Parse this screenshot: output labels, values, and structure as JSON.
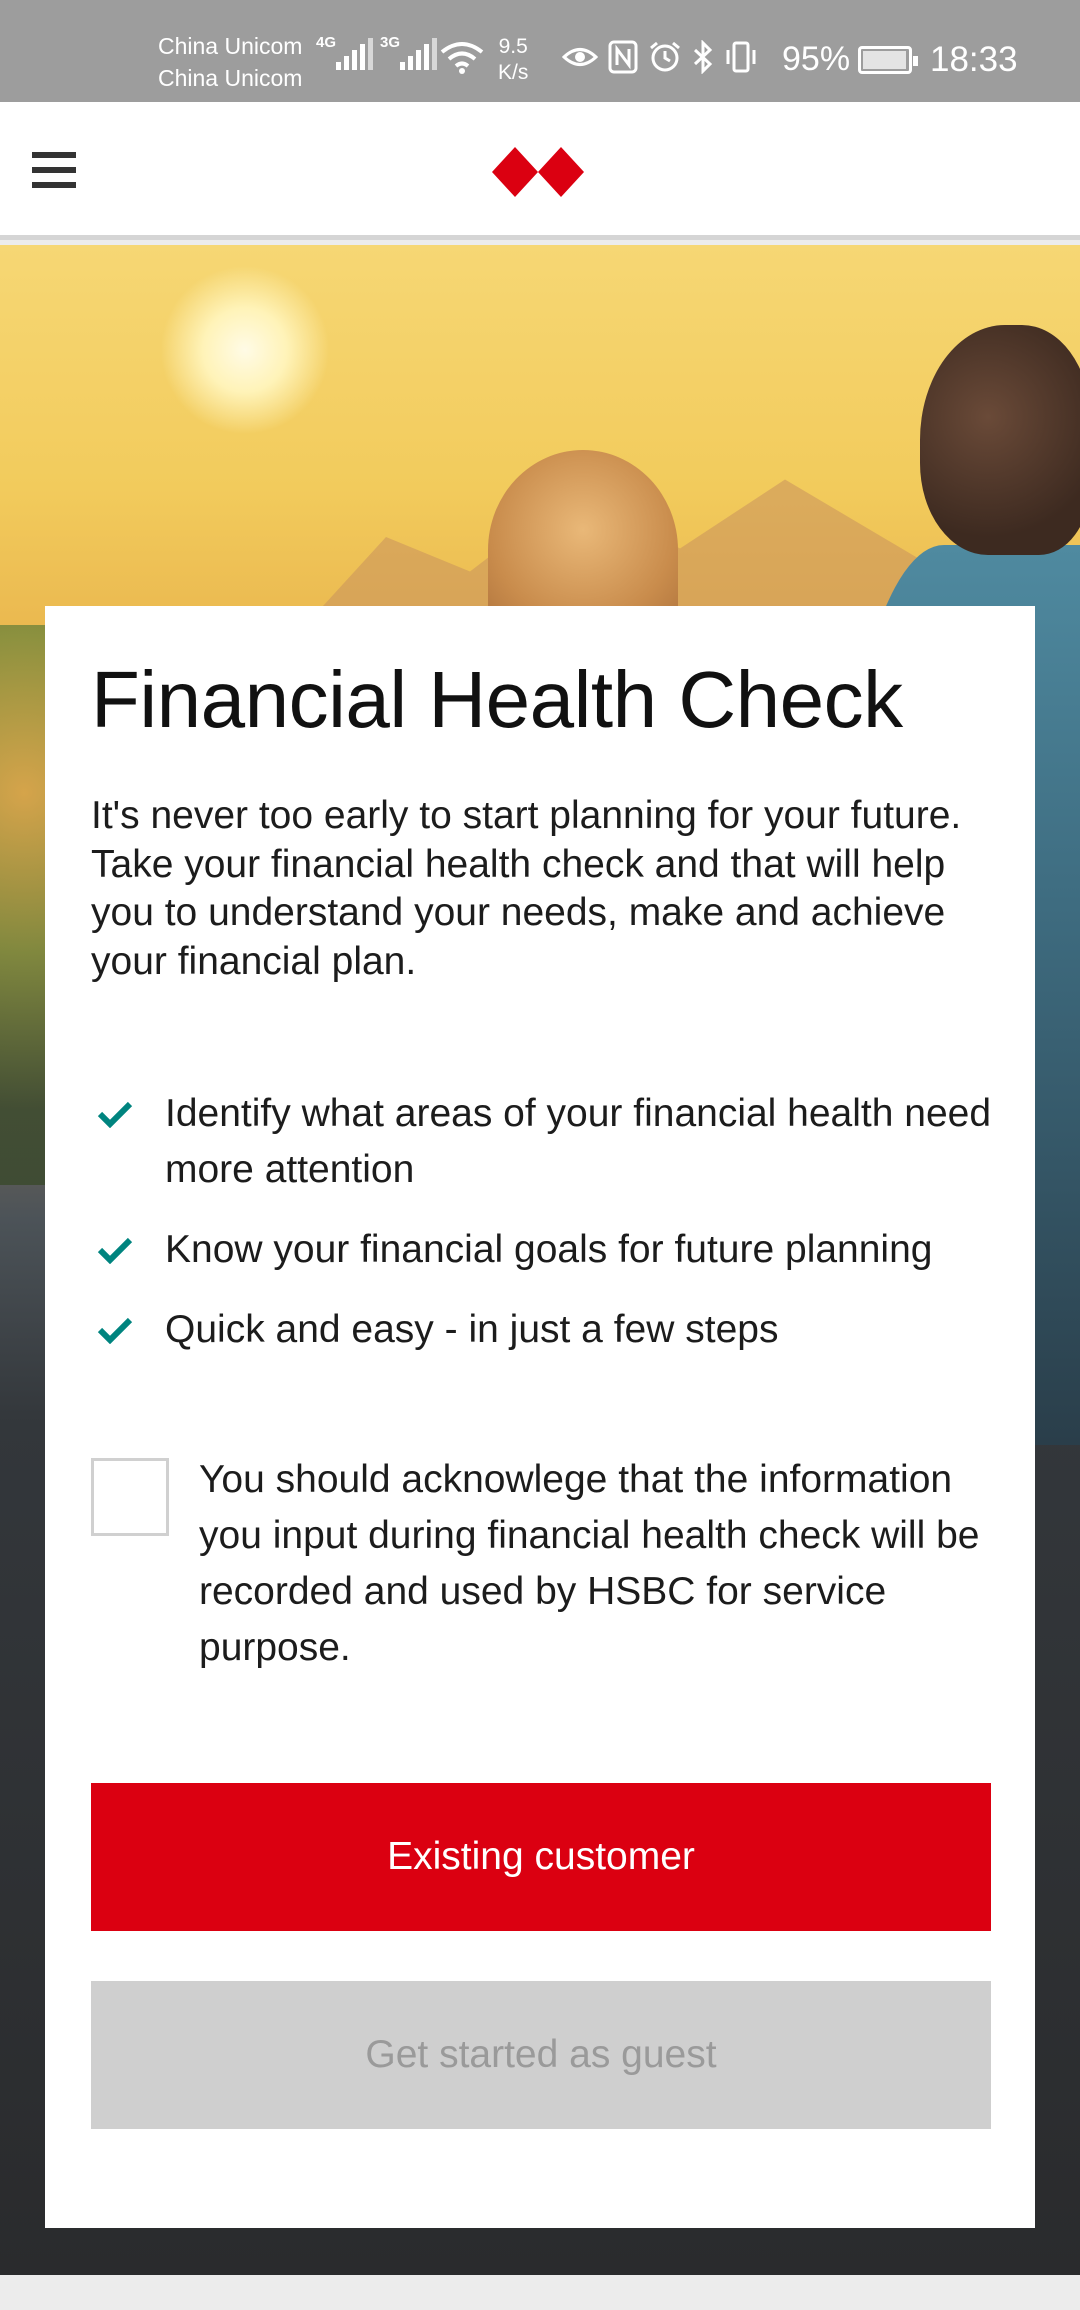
{
  "status_bar": {
    "carrier_1": "China Unicom",
    "carrier_2": "China Unicom",
    "network_1": "4G",
    "network_2": "3G",
    "speed_value": "9.5",
    "speed_unit": "K/s",
    "battery_percent": "95%",
    "time": "18:33",
    "icons": [
      "eye-icon",
      "nfc-icon",
      "alarm-icon",
      "bluetooth-icon",
      "vibrate-icon"
    ]
  },
  "header": {
    "menu_icon": "hamburger-icon",
    "logo": "hsbc-logo",
    "brand_color": "#db0011"
  },
  "card": {
    "title": "Financial Health Check",
    "intro": "It's never too early to start planning for your future. Take your financial health check and that will help you to understand your needs, make and achieve your financial plan.",
    "benefits": [
      "Identify what areas of your financial health need more attention",
      "Know your financial goals for future planning",
      "Quick and easy - in just a few steps"
    ],
    "acknowledgement": "You should acknowlege that the information you input during financial health check will be recorded and used by HSBC for service purpose.",
    "acknowledgement_checked": false,
    "primary_button": "Existing customer",
    "secondary_button": "Get started as guest",
    "check_color": "#00847f"
  }
}
